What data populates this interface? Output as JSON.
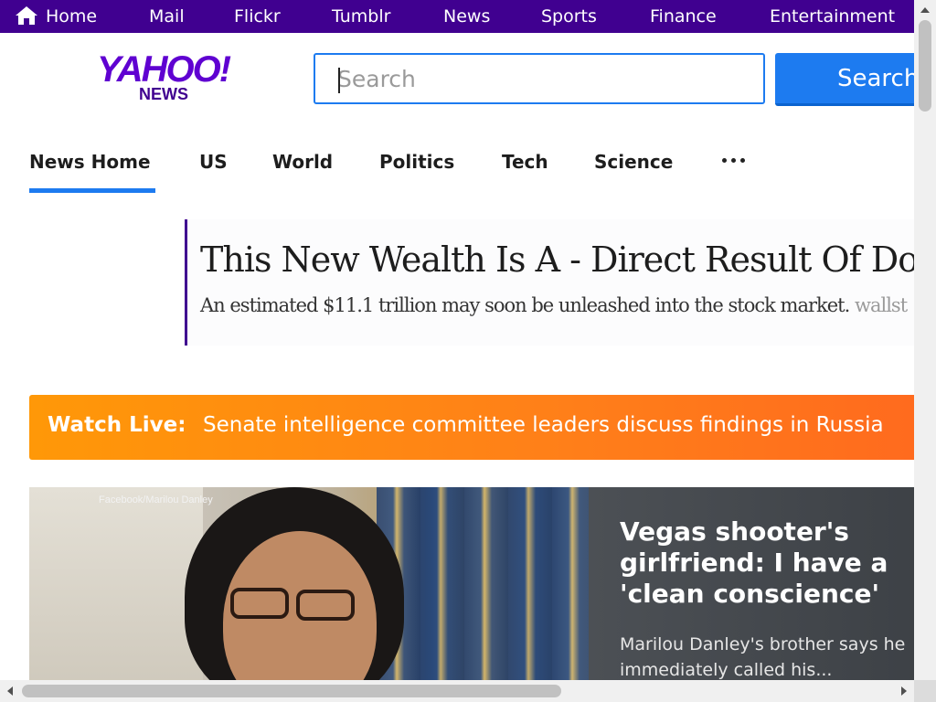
{
  "topnav": {
    "items": [
      {
        "label": "Home",
        "icon": "home-icon"
      },
      {
        "label": "Mail"
      },
      {
        "label": "Flickr"
      },
      {
        "label": "Tumblr"
      },
      {
        "label": "News"
      },
      {
        "label": "Sports"
      },
      {
        "label": "Finance"
      },
      {
        "label": "Entertainment"
      }
    ],
    "background": "#400090"
  },
  "logo": {
    "brand": "YAHOO!",
    "sub": "NEWS",
    "color": "#5f01d1"
  },
  "search": {
    "placeholder": "Search",
    "button_label": "Search",
    "accent": "#1d7bf0"
  },
  "sections": {
    "items": [
      "News Home",
      "US",
      "World",
      "Politics",
      "Tech",
      "Science"
    ],
    "active": "News Home",
    "more_icon": "more-dots-icon"
  },
  "ad": {
    "headline": "This New Wealth Is A - Direct Result Of Don",
    "description": "An estimated $11.1 trillion may soon be unleashed into the stock market.",
    "source": "wallst"
  },
  "live": {
    "label": "Watch Live:",
    "text": "Senate intelligence committee leaders discuss findings in Russia"
  },
  "feature": {
    "photo_credit": "Facebook/Marilou Danley",
    "title": "Vegas shooter's girlfriend: I have a 'clean conscience'",
    "summary": "Marilou Danley's brother says he immediately called his..."
  }
}
